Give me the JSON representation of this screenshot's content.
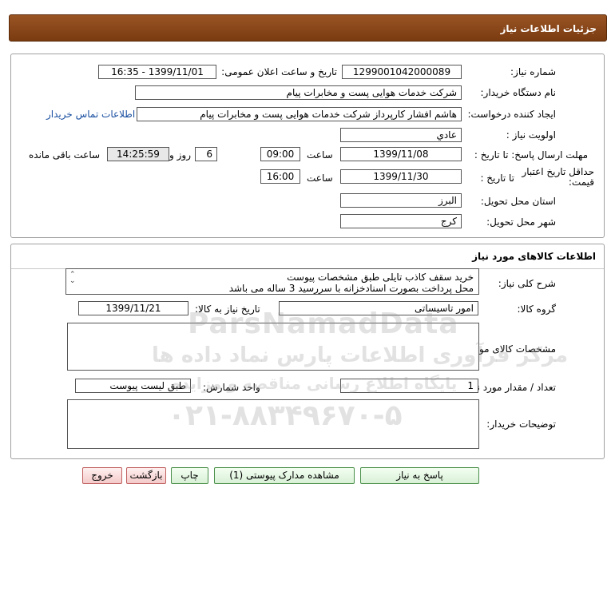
{
  "header": {
    "title": "جزئیات اطلاعات نیاز"
  },
  "need_info": {
    "need_number_label": "شماره نیاز:",
    "need_number": "1299001042000089",
    "announce_label": "تاریخ و ساعت اعلان عمومی:",
    "announce_value": "1399/11/01 - 16:35",
    "buyer_org_label": "نام دستگاه خریدار:",
    "buyer_org": "شرکت خدمات هوایی پست و مخابرات پیام",
    "requester_label": "ایجاد کننده درخواست:",
    "requester": "هاشم افشار کارپرداز شرکت خدمات هوایی پست و مخابرات پیام",
    "contact_link": "اطلاعات تماس خریدار",
    "priority_label": "اولویت نیاز :",
    "priority": "عادي",
    "deadline_label": "مهلت ارسال پاسخ:  تا تاریخ :",
    "deadline_date": "1399/11/08",
    "time_label": "ساعت",
    "deadline_time": "09:00",
    "days_value": "6",
    "days_suffix": "روز و",
    "remaining_time": "14:25:59",
    "remaining_label": "ساعت باقی مانده",
    "validity_label": "حداقل تاریخ اعتبار قیمت:",
    "validity_to_label": "تا تاریخ :",
    "validity_date": "1399/11/30",
    "validity_time_label": "ساعت",
    "validity_time": "16:00",
    "province_label": "استان محل تحویل:",
    "province": "البرز",
    "city_label": "شهر محل تحویل:",
    "city": "کرج"
  },
  "goods": {
    "section_title": "اطلاعات کالاهای مورد نیاز",
    "summary_label": "شرح کلی نیاز:",
    "summary_line1": "خرید سقف کاذب تایلی طبق مشخصات پیوست",
    "summary_line2": "محل پرداخت بصورت اسنادخزانه با سررسید 3 ساله می باشد",
    "group_label": "گروه کالا:",
    "group_value": "امور تاسیساتی",
    "need_date_label": "تاریخ نیاز به کالا:",
    "need_date": "1399/11/21",
    "specs_label": "مشخصات کالای مورد نیاز:",
    "specs_value": "",
    "qty_label": "تعداد / مقدار مورد نیاز:",
    "qty_value": "1",
    "unit_label": "واحد شمارش:",
    "unit_value": "طبق لیست پیوست",
    "buyer_notes_label": "توضیحات خریدار:",
    "buyer_notes": ""
  },
  "buttons": {
    "reply": "پاسخ به نیاز",
    "attachments": "مشاهده مدارک پیوستی (1)",
    "print": "چاپ",
    "back": "بازگشت",
    "exit": "خروج"
  },
  "watermark": {
    "brand": "ParsNamadData",
    "line1": "مرکز فرآوری اطلاعات پارس نماد داده ها",
    "line2": "پایگاه اطلاع رسانی مناقصه و مزایده",
    "phone": "۰۲۱-۸۸۳۴۹۶۷۰-۵"
  },
  "colors": {
    "header_bg": "#8b4513",
    "link": "#1a4fa0",
    "button_border": "#4a8f4a",
    "exit_border": "#c06060"
  }
}
